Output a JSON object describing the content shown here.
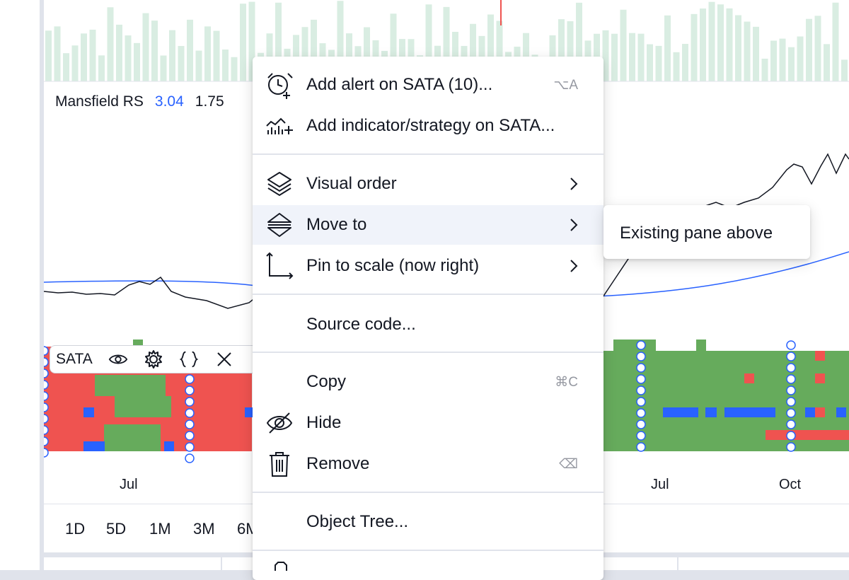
{
  "legend": {
    "name": "Mansfield RS",
    "value1": "3.04",
    "value2": "1.75"
  },
  "study_toolbar": {
    "name": "SATA"
  },
  "time_axis": [
    "Jul",
    "Jul",
    "Oct"
  ],
  "range_buttons": [
    "1D",
    "5D",
    "1M",
    "3M",
    "6M"
  ],
  "context_menu": {
    "items": [
      {
        "label": "Add alert on SATA (10)...",
        "shortcut": "⌥A",
        "icon": "alarm-clock-plus-icon"
      },
      {
        "label": "Add indicator/strategy on SATA...",
        "icon": "indicator-plus-icon"
      },
      {
        "label": "Visual order",
        "icon": "layers-icon",
        "has_submenu": true
      },
      {
        "label": "Move to",
        "icon": "move-pane-icon",
        "has_submenu": true,
        "active": true
      },
      {
        "label": "Pin to scale (now right)",
        "icon": "pin-scale-icon",
        "has_submenu": true
      },
      {
        "label": "Source code..."
      },
      {
        "label": "Copy",
        "shortcut": "⌘C"
      },
      {
        "label": "Hide",
        "icon": "eye-off-icon"
      },
      {
        "label": "Remove",
        "shortcut": "⌫",
        "icon": "trash-icon"
      },
      {
        "label": "Object Tree..."
      }
    ]
  },
  "submenu": {
    "items": [
      "Existing pane above"
    ]
  },
  "colors": {
    "rs_line": "#131722",
    "ma_line": "#2962ff",
    "volume_bar": "#d9ede2",
    "heat_red": "#ef5350",
    "heat_green": "#66ab5c",
    "heat_blue": "#2962ff"
  }
}
